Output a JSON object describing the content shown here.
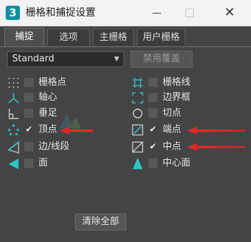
{
  "window": {
    "title": "栅格和捕捉设置",
    "app_icon_text": "3",
    "close_glyph": "✕"
  },
  "tabs": [
    {
      "label": "捕捉",
      "active": true
    },
    {
      "label": "选项",
      "active": false
    },
    {
      "label": "主栅格",
      "active": false
    },
    {
      "label": "用户栅格",
      "active": false
    }
  ],
  "toolbar": {
    "dropdown_value": "Standard",
    "override_label": "禁用覆盖"
  },
  "snaps": {
    "left": [
      {
        "label": "栅格点",
        "checked": false,
        "icon": "grid-points-icon"
      },
      {
        "label": "轴心",
        "checked": false,
        "icon": "pivot-icon"
      },
      {
        "label": "垂足",
        "checked": false,
        "icon": "perpendicular-icon"
      },
      {
        "label": "顶点",
        "checked": true,
        "icon": "vertex-icon"
      },
      {
        "label": "边/线段",
        "checked": false,
        "icon": "edge-segment-icon"
      },
      {
        "label": "面",
        "checked": false,
        "icon": "face-icon"
      }
    ],
    "right": [
      {
        "label": "栅格线",
        "checked": false,
        "icon": "grid-lines-icon"
      },
      {
        "label": "边界框",
        "checked": false,
        "icon": "bounding-box-icon"
      },
      {
        "label": "切点",
        "checked": false,
        "icon": "tangent-icon"
      },
      {
        "label": "端点",
        "checked": true,
        "icon": "endpoint-icon"
      },
      {
        "label": "中点",
        "checked": true,
        "icon": "midpoint-icon"
      },
      {
        "label": "中心面",
        "checked": false,
        "icon": "center-face-icon"
      }
    ]
  },
  "checkmark_glyph": "✔",
  "footer": {
    "clear_all_label": "清除全部"
  },
  "colors": {
    "accent_icon": "#2ec4c4",
    "arrow": "#e02828",
    "background": "#444444"
  }
}
